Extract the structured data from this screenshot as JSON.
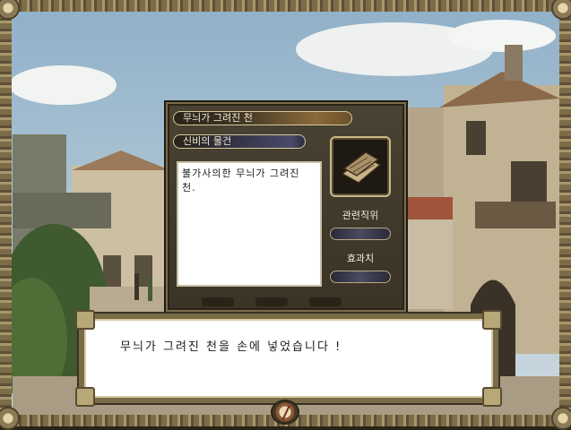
{
  "item_window": {
    "item_name": "무늬가 그려진 천",
    "category": "신비의 물건",
    "description": "불가사의한 무늬가 그려진 천.",
    "related_job_label": "관련직위",
    "related_job_value": "",
    "effect_label": "효과치",
    "effect_value": ""
  },
  "dialog": {
    "message": "무늬가 그려진 천을 손에 넣었습니다 !"
  },
  "icons": {
    "item_image": "folded-cloth-icon",
    "compass": "compass-icon"
  },
  "colors": {
    "panel_bg": "#3a3326",
    "frame_gold": "#8a7a55",
    "label_text": "#f2ead2"
  }
}
